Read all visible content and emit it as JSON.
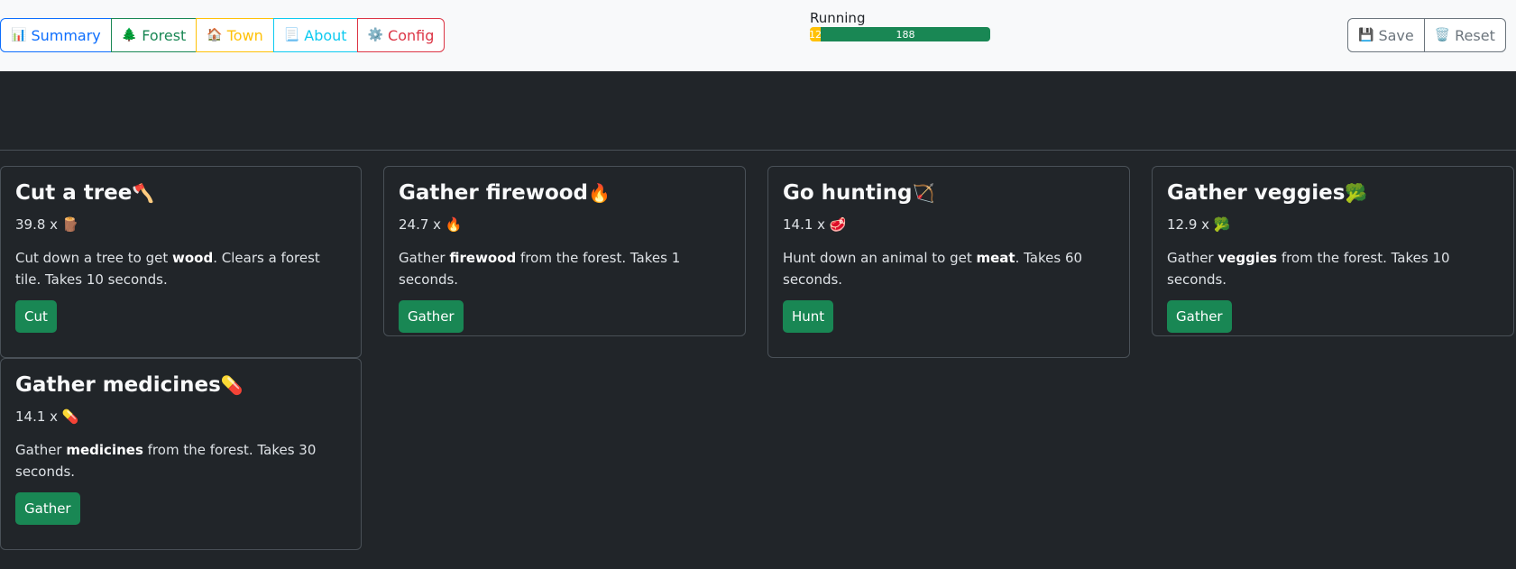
{
  "nav": {
    "summary": {
      "icon": "📊",
      "label": "Summary"
    },
    "forest": {
      "icon": "🌲",
      "label": "Forest"
    },
    "town": {
      "icon": "🏠",
      "label": "Town"
    },
    "about": {
      "icon": "📃",
      "label": "About"
    },
    "config": {
      "icon": "⚙️",
      "label": "Config"
    }
  },
  "status": {
    "label": "Running",
    "progress_yellow": {
      "label": "12",
      "value": 12,
      "color": "#ffc107"
    },
    "progress_green": {
      "label": "188",
      "value": 188,
      "color": "#198754"
    }
  },
  "actions": {
    "save": {
      "icon": "💾",
      "label": "Save"
    },
    "reset": {
      "icon": "🗑️",
      "label": "Reset"
    }
  },
  "cards": [
    {
      "title": "Cut a tree",
      "emoji": "🪓",
      "amount": "39.8 x",
      "amount_icon": "🪵",
      "desc_pre": "Cut down a tree to get ",
      "desc_bold": "wood",
      "desc_post": ". Clears a forest tile. Takes 10 seconds.",
      "button": "Cut"
    },
    {
      "title": "Gather firewood",
      "emoji": "🔥",
      "amount": "24.7 x",
      "amount_icon": "🔥",
      "desc_pre": "Gather ",
      "desc_bold": "firewood",
      "desc_post": " from the forest. Takes 1 seconds.",
      "button": "Gather"
    },
    {
      "title": "Go hunting",
      "emoji": "🏹",
      "amount": "14.1 x",
      "amount_icon": "🥩",
      "desc_pre": "Hunt down an animal to get ",
      "desc_bold": "meat",
      "desc_post": ". Takes 60 seconds.",
      "button": "Hunt"
    },
    {
      "title": "Gather veggies",
      "emoji": "🥦",
      "amount": "12.9 x",
      "amount_icon": "🥦",
      "desc_pre": "Gather ",
      "desc_bold": "veggies",
      "desc_post": " from the forest. Takes 10 seconds.",
      "button": "Gather"
    },
    {
      "title": "Gather medicines",
      "emoji": "💊",
      "amount": "14.1 x",
      "amount_icon": "💊",
      "desc_pre": "Gather ",
      "desc_bold": "medicines",
      "desc_post": " from the forest. Takes 30 seconds.",
      "button": "Gather"
    }
  ]
}
